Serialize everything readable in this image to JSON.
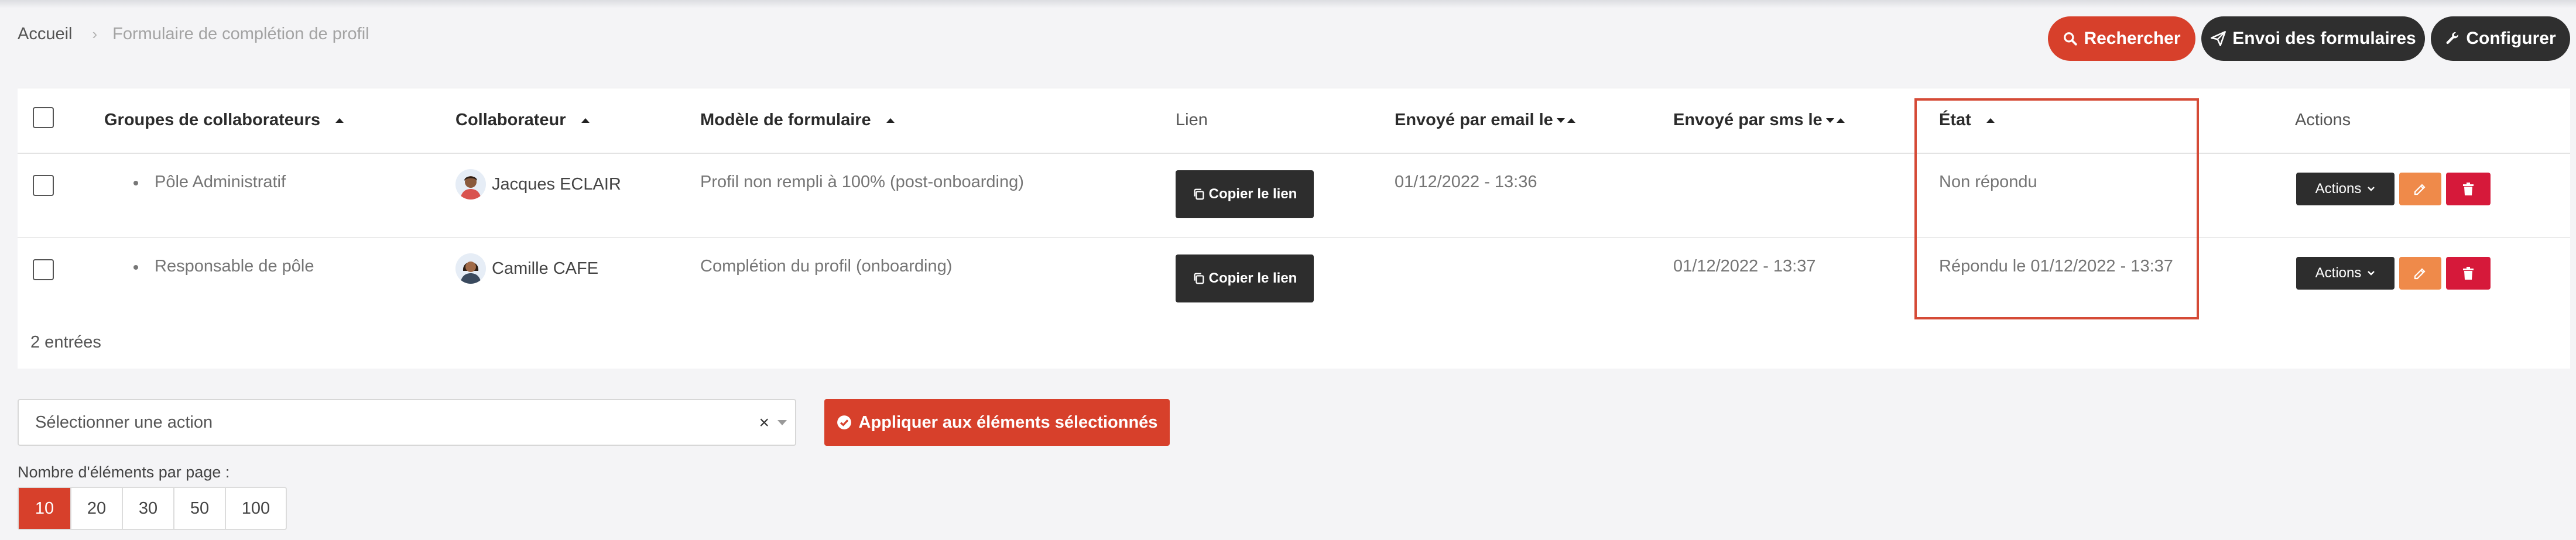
{
  "breadcrumb": {
    "home": "Accueil",
    "separator": "›",
    "current": "Formulaire de complétion de profil"
  },
  "toolbar": {
    "search_label": "Rechercher",
    "send_label": "Envoi des formulaires",
    "config_label": "Configurer"
  },
  "table": {
    "columns": {
      "group": "Groupes de collaborateurs",
      "employee": "Collaborateur",
      "template": "Modèle de formulaire",
      "link": "Lien",
      "sent_email": "Envoyé par email le",
      "sent_sms": "Envoyé par sms le",
      "state": "État",
      "actions": "Actions"
    },
    "rows": [
      {
        "group": "Pôle Administratif",
        "employee": "Jacques ECLAIR",
        "template": "Profil non rempli à 100% (post-onboarding)",
        "copy_label": "Copier le lien",
        "sent_email": "01/12/2022 - 13:36",
        "sent_sms": "",
        "state": "Non répondu",
        "actions_label": "Actions"
      },
      {
        "group": "Responsable de pôle",
        "employee": "Camille CAFE",
        "template": "Complétion du profil (onboarding)",
        "copy_label": "Copier le lien",
        "sent_email": "",
        "sent_sms": "01/12/2022 - 13:37",
        "state": "Répondu le 01/12/2022 - 13:37",
        "actions_label": "Actions"
      }
    ],
    "entries_count": "2 entrées"
  },
  "bulk": {
    "select_placeholder": "Sélectionner une action",
    "clear_symbol": "×",
    "apply_label": "Appliquer aux éléments sélectionnés"
  },
  "pagination": {
    "label": "Nombre d'éléments par page :",
    "options": [
      "10",
      "20",
      "30",
      "50",
      "100"
    ],
    "selected": "10"
  },
  "colors": {
    "accent": "#d7402b",
    "dark_button": "#2f2f2f",
    "edit_button": "#ef8a4a",
    "delete_button": "#d6193a",
    "highlight_border": "#d54a36"
  }
}
